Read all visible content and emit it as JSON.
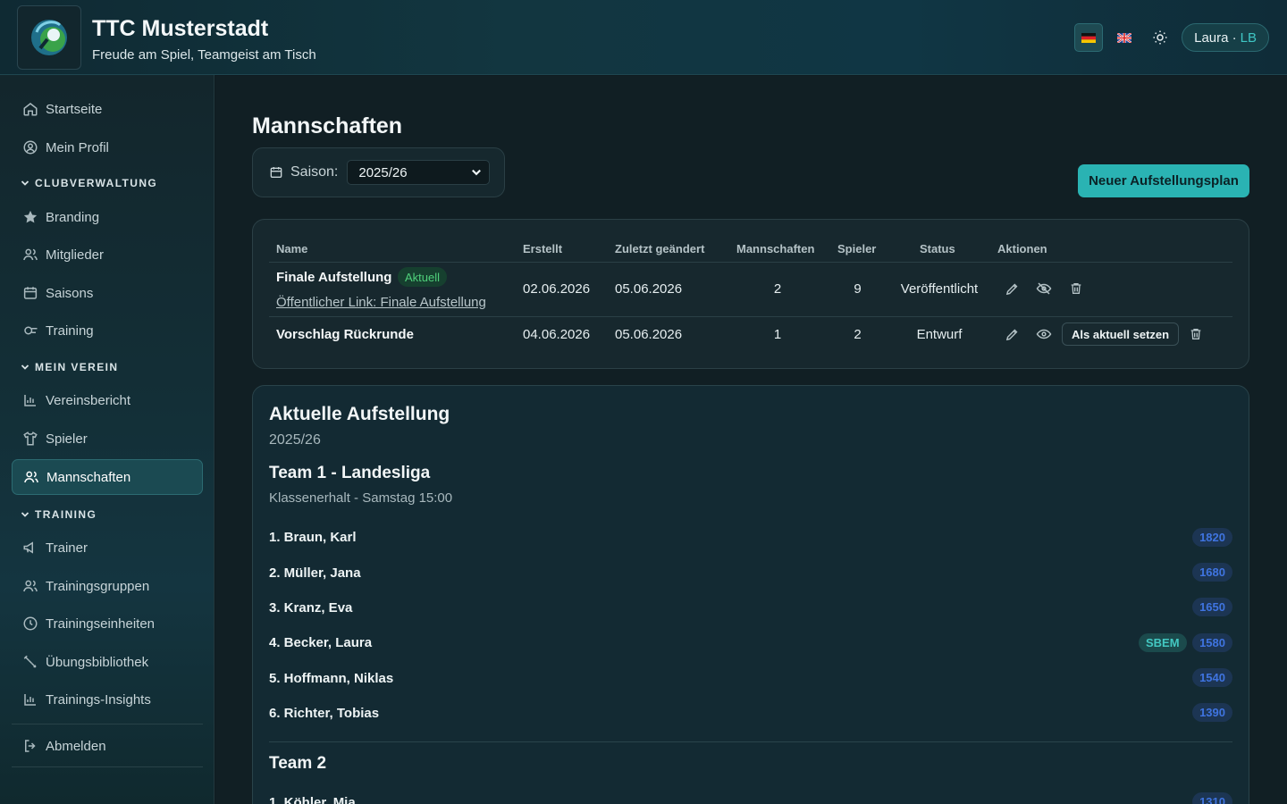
{
  "header": {
    "club_name": "TTC Musterstadt",
    "tagline": "Freude am Spiel, Teamgeist am Tisch",
    "user_name": "Laura ·",
    "user_initials": "LB"
  },
  "sidebar": {
    "top_items": [
      {
        "label": "Startseite",
        "icon": "home-icon"
      },
      {
        "label": "Mein Profil",
        "icon": "user-circle-icon"
      }
    ],
    "sections": [
      {
        "title": "CLUBVERWALTUNG",
        "items": [
          {
            "label": "Branding",
            "icon": "star-icon"
          },
          {
            "label": "Mitglieder",
            "icon": "users-icon"
          },
          {
            "label": "Saisons",
            "icon": "calendar-icon"
          },
          {
            "label": "Training",
            "icon": "ball-icon"
          }
        ]
      },
      {
        "title": "MEIN VEREIN",
        "items": [
          {
            "label": "Vereinsbericht",
            "icon": "bar-chart-icon"
          },
          {
            "label": "Spieler",
            "icon": "shirt-icon"
          },
          {
            "label": "Mannschaften",
            "icon": "users-icon",
            "active": true
          }
        ]
      },
      {
        "title": "TRAINING",
        "items": [
          {
            "label": "Trainer",
            "icon": "megaphone-icon"
          },
          {
            "label": "Trainingsgruppen",
            "icon": "users-icon"
          },
          {
            "label": "Trainingseinheiten",
            "icon": "clock-icon"
          },
          {
            "label": "Übungsbibliothek",
            "icon": "tools-icon"
          },
          {
            "label": "Trainings-Insights",
            "icon": "bar-chart-icon"
          }
        ]
      }
    ],
    "logout": "Abmelden"
  },
  "main": {
    "title": "Mannschaften",
    "season_label": "Saison:",
    "season_value": "2025/26",
    "new_plan_button": "Neuer Aufstellungsplan",
    "table": {
      "headers": [
        "Name",
        "Erstellt",
        "Zuletzt geändert",
        "Mannschaften",
        "Spieler",
        "Status",
        "Aktionen"
      ],
      "rows": [
        {
          "name": "Finale Aufstellung",
          "badge": "Aktuell",
          "link": "Öffentlicher Link: Finale Aufstellung",
          "created": "02.06.2026",
          "modified": "05.06.2026",
          "teams": "2",
          "players": "9",
          "status": "Veröffentlicht"
        },
        {
          "name": "Vorschlag Rückrunde",
          "created": "04.06.2026",
          "modified": "05.06.2026",
          "teams": "1",
          "players": "2",
          "status": "Entwurf",
          "set_current_button": "Als aktuell setzen"
        }
      ]
    },
    "lineup": {
      "title": "Aktuelle Aufstellung",
      "season": "2025/26",
      "team1": {
        "name": "Team 1 - Landesliga",
        "desc": "Klassenerhalt - Samstag 15:00",
        "players": [
          {
            "name": "1. Braun, Karl",
            "rating": "1820"
          },
          {
            "name": "2. Müller, Jana",
            "rating": "1680"
          },
          {
            "name": "3. Kranz, Eva",
            "rating": "1650"
          },
          {
            "name": "4. Becker, Laura",
            "rating": "1580",
            "tag": "SBEM"
          },
          {
            "name": "5. Hoffmann, Niklas",
            "rating": "1540"
          },
          {
            "name": "6. Richter, Tobias",
            "rating": "1390"
          }
        ]
      },
      "team2": {
        "name": "Team 2",
        "players": [
          {
            "name": "1. Köhler, Mia",
            "rating": "1310"
          }
        ]
      }
    }
  },
  "colors": {
    "accent": "#2ab3b3",
    "active_badge": "#4fd07b",
    "rating_badge": "#3f74e0"
  }
}
